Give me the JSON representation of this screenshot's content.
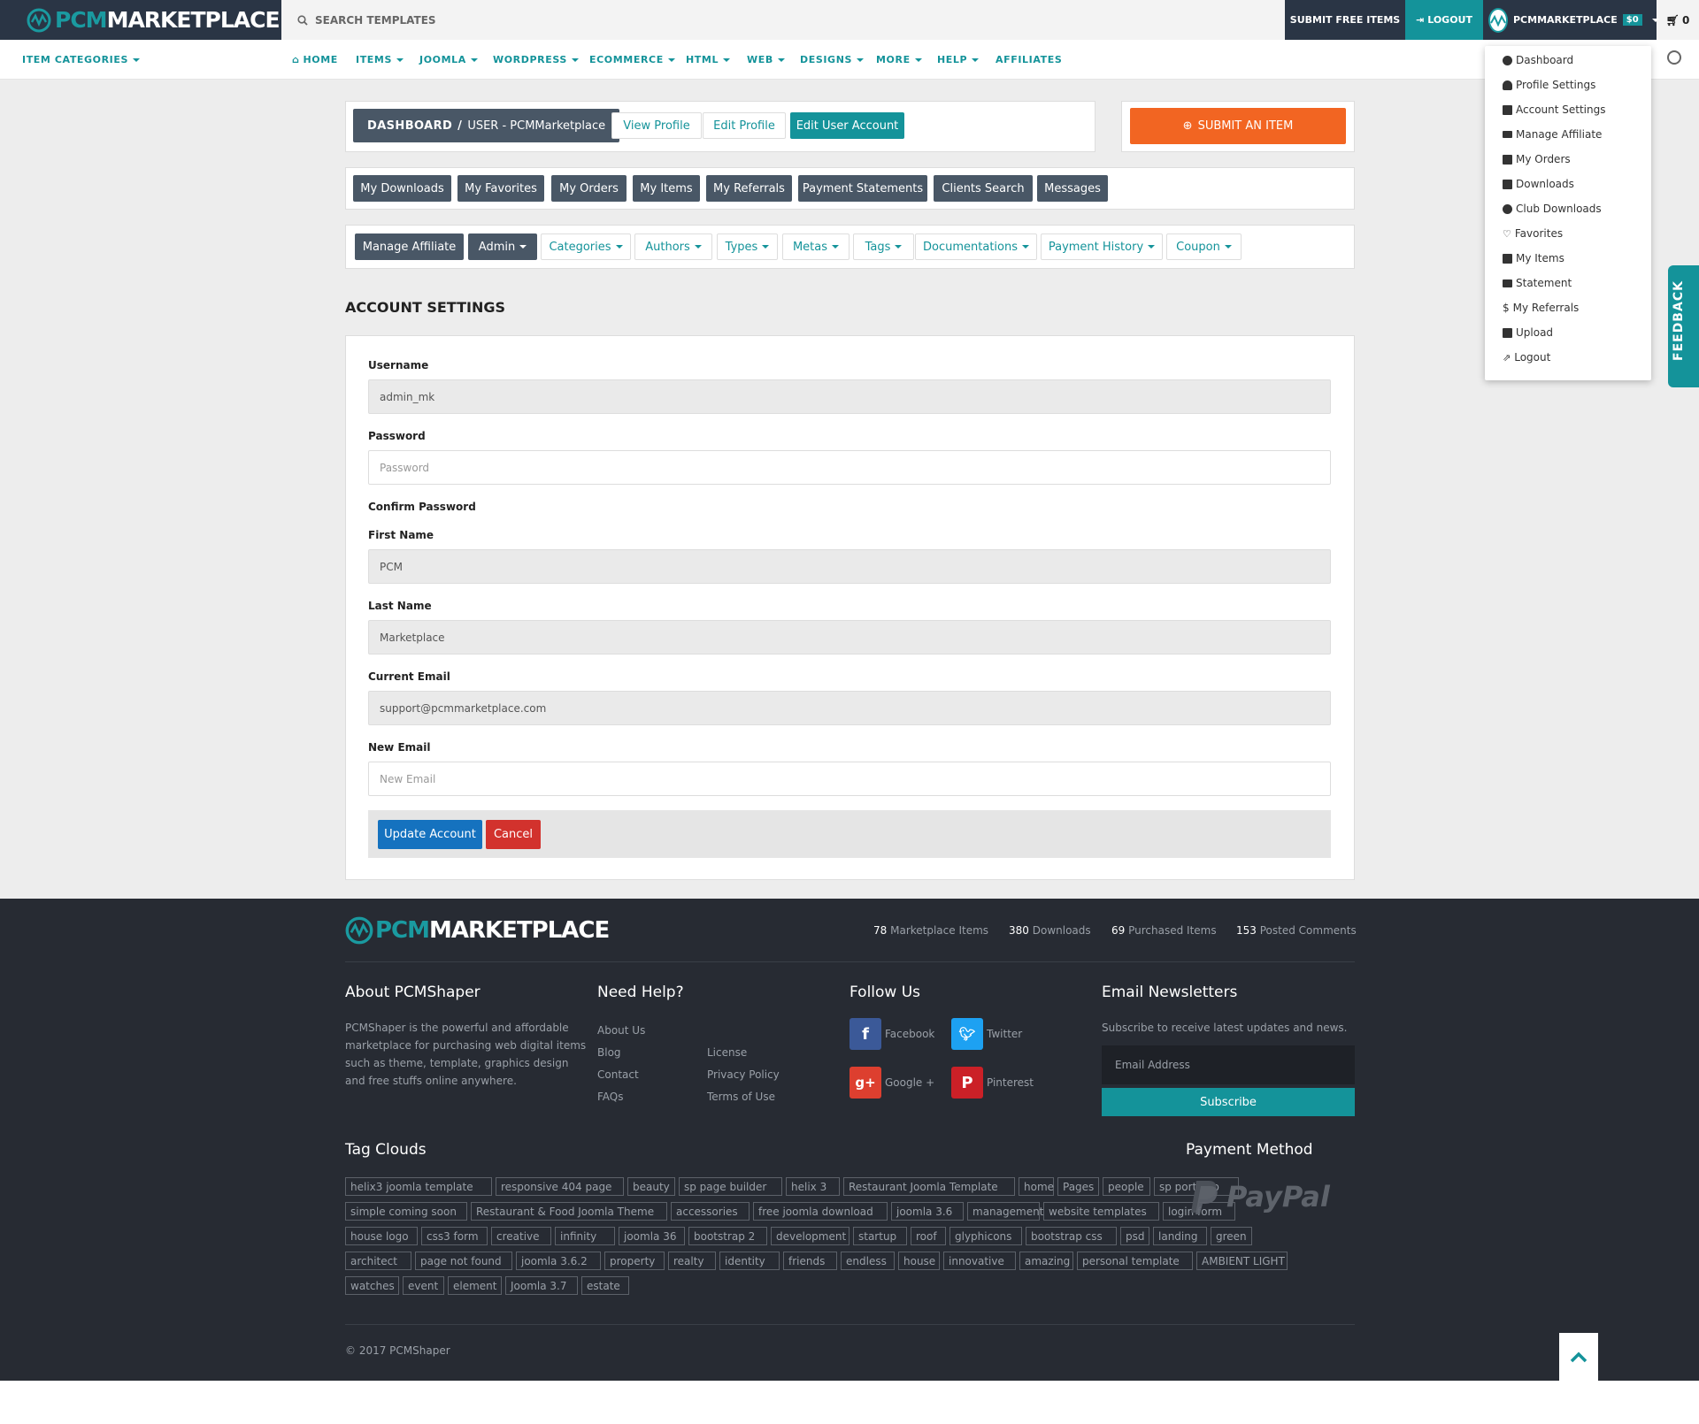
{
  "topbar": {
    "logo_a": "PCM",
    "logo_b": "MARKETPLACE",
    "search_placeholder": "SEARCH TEMPLATES",
    "submit_free": "SUBMIT FREE ITEMS",
    "logout": "LOGOUT",
    "user_name": "PCMMARKETPLACE",
    "balance": "$0",
    "cart_count": "0"
  },
  "nav": {
    "categories": "ITEM CATEGORIES",
    "items": [
      "HOME",
      "ITEMS",
      "JOOMLA",
      "WORDPRESS",
      "ECOMMERCE",
      "HTML",
      "WEB",
      "DESIGNS",
      "MORE",
      "HELP",
      "AFFILIATES"
    ]
  },
  "breadcrumb": {
    "root": "DASHBOARD",
    "sep": "/",
    "current": "USER - PCMMarketplace"
  },
  "profile_buttons": [
    "View Profile",
    "Edit Profile",
    "Edit User Account"
  ],
  "submit_item": "SUBMIT AN ITEM",
  "user_tabs": [
    "My Downloads",
    "My Favorites",
    "My Orders",
    "My Items",
    "My Referrals",
    "Payment Statements",
    "Clients Search",
    "Messages"
  ],
  "admin_tabs": [
    "Manage Affiliate",
    "Admin",
    "Categories",
    "Authors",
    "Types",
    "Metas",
    "Tags",
    "Documentations",
    "Payment History",
    "Coupon"
  ],
  "form": {
    "title": "ACCOUNT SETTINGS",
    "username_label": "Username",
    "username_value": "admin_mk",
    "password_label": "Password",
    "password_placeholder": "Password",
    "confirm_label": "Confirm Password",
    "first_label": "First Name",
    "first_value": "PCM",
    "last_label": "Last Name",
    "last_value": "Marketplace",
    "email_label": "Current Email",
    "email_value": "support@pcmmarketplace.com",
    "newemail_label": "New Email",
    "newemail_placeholder": "New Email",
    "update": "Update Account",
    "cancel": "Cancel"
  },
  "dropdown": [
    "Dashboard",
    "Profile Settings",
    "Account Settings",
    "Manage Affiliate",
    "My Orders",
    "Downloads",
    "Club Downloads",
    "Favorites",
    "My Items",
    "Statement",
    "My Referrals",
    "Upload",
    "Logout"
  ],
  "feedback": "FEEDBACK",
  "footer": {
    "stats": [
      {
        "n": "78",
        "t": "Marketplace Items"
      },
      {
        "n": "380",
        "t": "Downloads"
      },
      {
        "n": "69",
        "t": "Purchased Items"
      },
      {
        "n": "153",
        "t": "Posted Comments"
      }
    ],
    "about_title": "About PCMShaper",
    "about_text": "PCMShaper is the powerful and affordable marketplace for purchasing web digital items such as theme, template, graphics design and free stuffs online anywhere.",
    "help_title": "Need Help?",
    "help_col1": [
      "About Us",
      "Blog",
      "Contact",
      "FAQs"
    ],
    "help_col2": [
      "License",
      "Privacy Policy",
      "Terms of Use"
    ],
    "follow_title": "Follow Us",
    "social": [
      "Facebook",
      "Twitter",
      "Google +",
      "Pinterest"
    ],
    "news_title": "Email Newsletters",
    "news_text": "Subscribe to receive latest updates and news.",
    "news_placeholder": "Email Address",
    "subscribe": "Subscribe",
    "tags_title": "Tag Clouds",
    "tags": [
      [
        "helix3 joomla template",
        "responsive 404 page",
        "beauty",
        "sp page builder",
        "helix 3",
        "Restaurant Joomla Template",
        "home",
        "Pages",
        "people",
        "sp portfolio"
      ],
      [
        "simple coming soon",
        "Restaurant & Food Joomla Theme",
        "accessories",
        "free joomla download",
        "joomla 3.6",
        "management",
        "website templates",
        "login form"
      ],
      [
        "house logo",
        "css3 form",
        "creative",
        "infinity",
        "joomla 36",
        "bootstrap 2",
        "development",
        "startup",
        "roof",
        "glyphicons",
        "bootstrap css",
        "psd",
        "landing",
        "green"
      ],
      [
        "architect",
        "page not found",
        "joomla 3.6.2",
        "property",
        "realty",
        "identity",
        "friends",
        "endless",
        "house",
        "innovative",
        "amazing",
        "personal template",
        "AMBIENT LIGHT"
      ],
      [
        "watches",
        "event",
        "element",
        "Joomla 3.7",
        "estate"
      ]
    ],
    "payment_title": "Payment Method",
    "paypal": "PayPal",
    "copyright": "© 2017 PCMShaper"
  },
  "colors": {
    "teal": "#14939a",
    "navy": "#2a3545",
    "slate": "#495766",
    "orange": "#f26522",
    "footer": "#272b33"
  }
}
